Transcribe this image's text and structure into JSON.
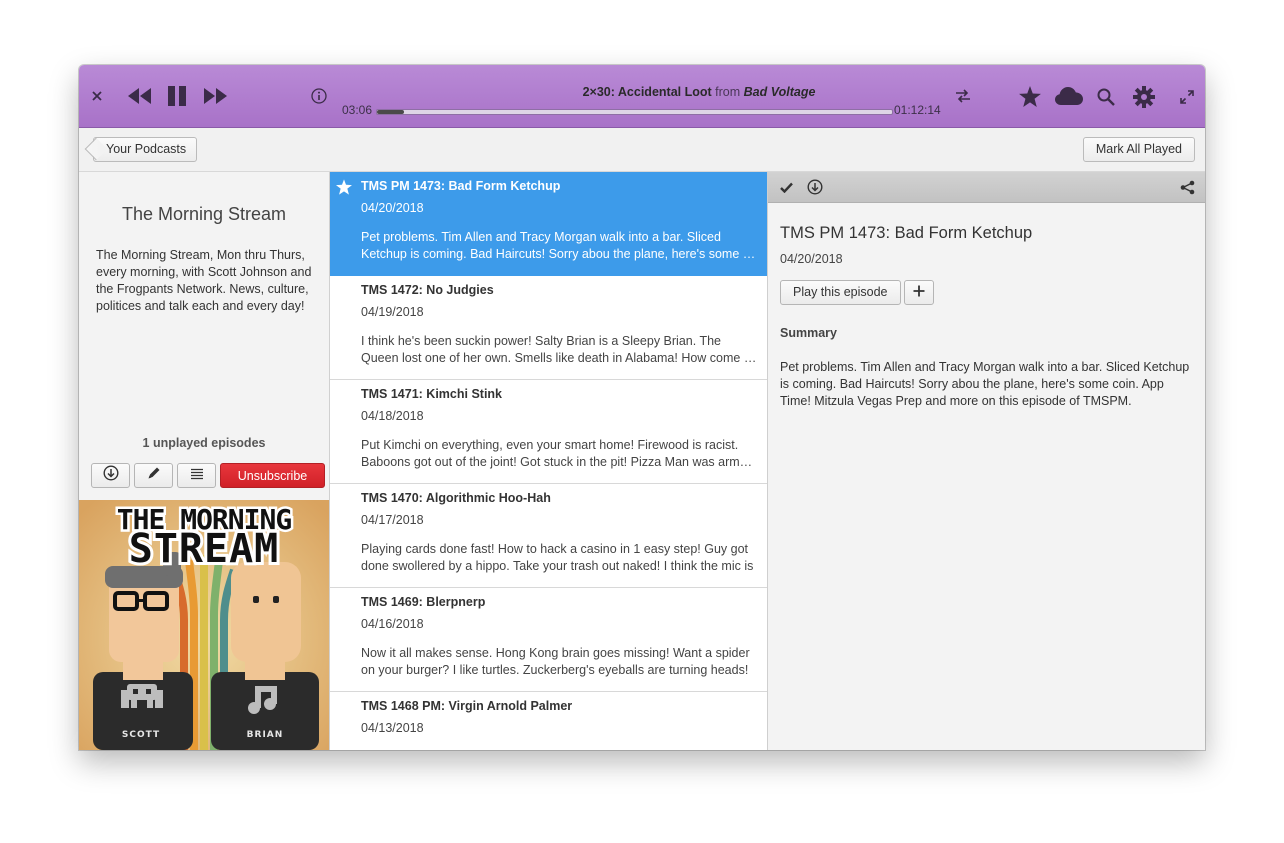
{
  "player": {
    "episode_title": "2×30: Accidental Loot",
    "from_word": "from",
    "show_name": "Bad Voltage",
    "elapsed": "03:06",
    "remaining": "01:12:14",
    "progress_fraction": 0.053
  },
  "toolbar": {
    "back_label": "Your Podcasts",
    "mark_all_label": "Mark All Played"
  },
  "podcast": {
    "title": "The Morning Stream",
    "description": "The Morning Stream, Mon thru Thurs, every morning, with Scott Johnson and the Frogpants Network.  News, culture, politices and talk each and every day!",
    "unplayed": "1 unplayed episodes",
    "unsubscribe_label": "Unsubscribe",
    "art": {
      "line1": "THE MORNING",
      "line2": "STREAM",
      "name_left": "SCOTT",
      "name_right": "BRIAN"
    }
  },
  "episodes": [
    {
      "title": "TMS PM 1473: Bad Form Ketchup",
      "date": "04/20/2018",
      "line1": "Pet problems. Tim Allen and Tracy Morgan walk into a bar. Sliced",
      "line2": "Ketchup is coming. Bad Haircuts! Sorry abou the plane, here's some coin.",
      "starred": true,
      "selected": true
    },
    {
      "title": "TMS 1472: No Judgies",
      "date": "04/19/2018",
      "line1": "I think he's been suckin power! Salty Brian is a Sleepy Brian. The",
      "line2": "Queen lost one of her own. Smells like death in Alabama! How come nobody",
      "starred": false,
      "selected": false
    },
    {
      "title": "TMS 1471: Kimchi Stink",
      "date": "04/18/2018",
      "line1": "Put Kimchi on everything, even your smart home! Firewood is racist.",
      "line2": "Baboons got out of the joint! Got stuck in the pit! Pizza Man was armed!",
      "starred": false,
      "selected": false
    },
    {
      "title": "TMS 1470: Algorithmic Hoo-Hah",
      "date": "04/17/2018",
      "line1": "Playing cards done fast! How to hack a casino in 1 easy step! Guy got",
      "line2": "done swollered by a hippo. Take your trash out naked! I think the mic is",
      "starred": false,
      "selected": false
    },
    {
      "title": "TMS 1469: Blerpnerp",
      "date": "04/16/2018",
      "line1": "Now it all makes sense. Hong Kong brain goes missing! Want a spider",
      "line2": "on your burger? I like turtles. Zuckerberg's eyeballs are turning heads!",
      "starred": false,
      "selected": false
    },
    {
      "title": "TMS 1468 PM: Virgin Arnold Palmer",
      "date": "04/13/2018",
      "line1": "",
      "line2": "",
      "starred": false,
      "selected": false
    }
  ],
  "details": {
    "title": "TMS PM 1473: Bad Form Ketchup",
    "date": "04/20/2018",
    "play_label": "Play this episode",
    "summary_heading": "Summary",
    "summary": "Pet problems. Tim Allen and Tracy Morgan walk into a bar. Sliced Ketchup is coming. Bad Haircuts! Sorry abou the plane, here's some coin. App Time! Mitzula Vegas Prep and more on this episode of TMSPM."
  },
  "icons": {
    "close": "close-icon",
    "rewind": "rewind-icon",
    "pause": "pause-icon",
    "forward": "fast-forward-icon",
    "info": "info-icon",
    "shuffle": "shuffle-icon",
    "star": "star-icon",
    "cloud": "cloud-icon",
    "search": "search-icon",
    "settings": "gear-icon",
    "fullscreen": "fullscreen-icon"
  },
  "colors": {
    "header": "#a872c8",
    "selection": "#3d9bea",
    "unsubscribe": "#d02128"
  }
}
